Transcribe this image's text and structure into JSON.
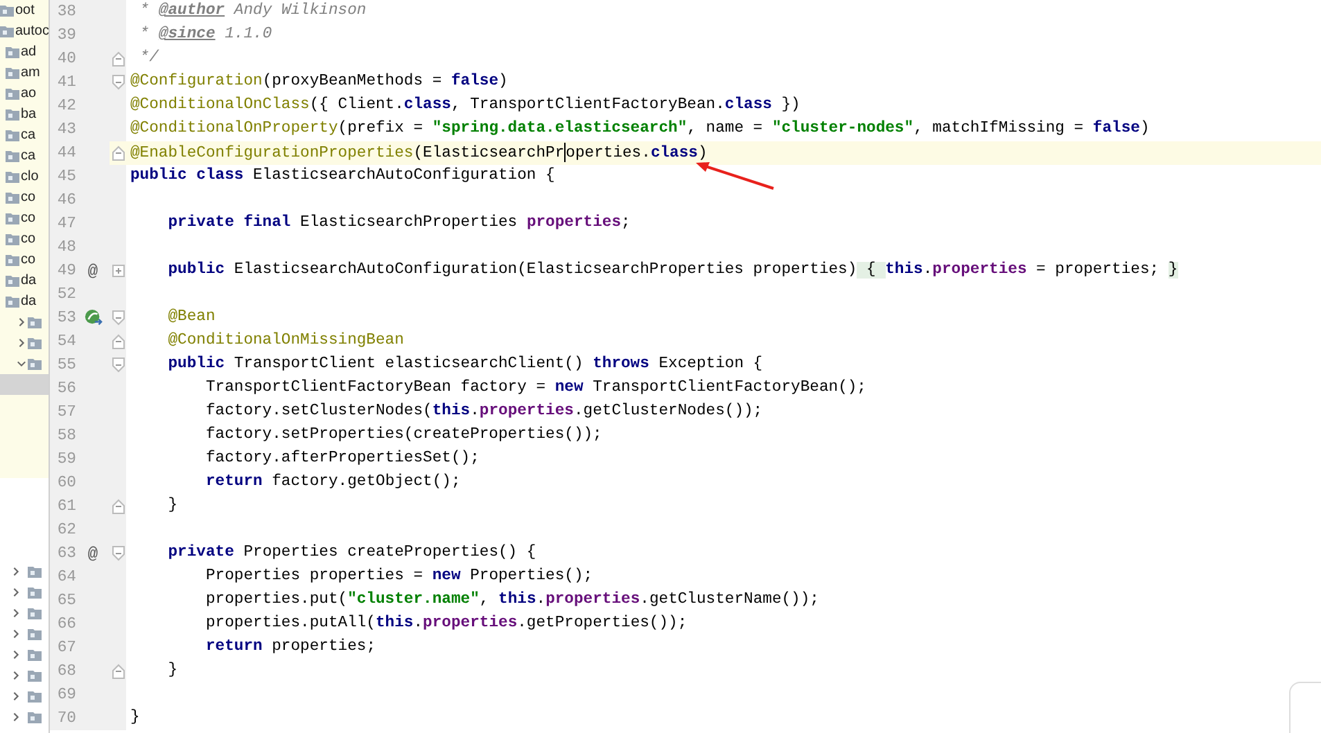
{
  "sidebar": {
    "tree": [
      {
        "label": "oot",
        "selected": false
      },
      {
        "label": "autoc",
        "selected": false,
        "children": [
          {
            "label": "ad",
            "selected": false
          },
          {
            "label": "am",
            "selected": false
          },
          {
            "label": "ao",
            "selected": false
          },
          {
            "label": "ba",
            "selected": false
          },
          {
            "label": "ca",
            "selected": false
          },
          {
            "label": "ca",
            "selected": false
          },
          {
            "label": "clo",
            "selected": false
          },
          {
            "label": "co",
            "selected": false
          },
          {
            "label": "co",
            "selected": false
          },
          {
            "label": "co",
            "selected": false
          },
          {
            "label": "co",
            "selected": false
          },
          {
            "label": "da",
            "selected": false
          },
          {
            "label": "da",
            "selected": false,
            "children": [
              {
                "selected": false,
                "expanded": false
              },
              {
                "selected": false,
                "expanded": false
              },
              {
                "selected": false,
                "expanded": true,
                "children": [
                  {
                    "selected": true
                  }
                ]
              }
            ]
          }
        ]
      }
    ],
    "lower_items": [
      {
        "selected": false,
        "expanded": false
      },
      {
        "selected": false,
        "expanded": false
      },
      {
        "selected": false,
        "expanded": false
      },
      {
        "selected": false,
        "expanded": false
      },
      {
        "selected": false,
        "expanded": false
      },
      {
        "selected": false,
        "expanded": false
      },
      {
        "selected": false,
        "expanded": false
      },
      {
        "selected": false,
        "expanded": false
      }
    ]
  },
  "editor": {
    "lines": [
      {
        "number": "38",
        "tokens": [
          {
            "kind": "comment",
            "t": " * "
          },
          {
            "kind": "doctag",
            "t": "@author"
          },
          {
            "kind": "comment",
            "t": " Andy Wilkinson"
          }
        ]
      },
      {
        "number": "39",
        "tokens": [
          {
            "kind": "comment",
            "t": " * "
          },
          {
            "kind": "doctag",
            "t": "@since"
          },
          {
            "kind": "comment",
            "t": " 1.1.0"
          }
        ]
      },
      {
        "number": "40",
        "fold": {
          "kind": "close"
        },
        "tokens": [
          {
            "kind": "comment",
            "t": " */"
          }
        ]
      },
      {
        "number": "41",
        "fold": {
          "kind": "open"
        },
        "tokens": [
          {
            "kind": "ann",
            "t": "@Configuration"
          },
          {
            "kind": "plain",
            "t": "(proxyBeanMethods = "
          },
          {
            "kind": "kw",
            "t": "false"
          },
          {
            "kind": "plain",
            "t": ")"
          }
        ]
      },
      {
        "number": "42",
        "tokens": [
          {
            "kind": "ann",
            "t": "@ConditionalOnClass"
          },
          {
            "kind": "plain",
            "t": "({ Client."
          },
          {
            "kind": "kw",
            "t": "class"
          },
          {
            "kind": "plain",
            "t": ", TransportClientFactoryBean."
          },
          {
            "kind": "kw",
            "t": "class"
          },
          {
            "kind": "plain",
            "t": " })"
          }
        ]
      },
      {
        "number": "43",
        "tokens": [
          {
            "kind": "ann",
            "t": "@ConditionalOnProperty"
          },
          {
            "kind": "plain",
            "t": "(prefix = "
          },
          {
            "kind": "str",
            "t": "\"spring.data.elasticsearch\""
          },
          {
            "kind": "plain",
            "t": ", name = "
          },
          {
            "kind": "str",
            "t": "\"cluster-nodes\""
          },
          {
            "kind": "plain",
            "t": ", matchIfMissing = "
          },
          {
            "kind": "kw",
            "t": "false"
          },
          {
            "kind": "plain",
            "t": ")"
          }
        ]
      },
      {
        "number": "44",
        "fold": {
          "kind": "close"
        },
        "current": true,
        "tokens": [
          {
            "kind": "ann",
            "t": "@EnableConfigurationProperties"
          },
          {
            "kind": "plain",
            "t": "(ElasticsearchPr"
          },
          {
            "kind": "caret"
          },
          {
            "kind": "plain",
            "t": "operties."
          },
          {
            "kind": "kw",
            "t": "class"
          },
          {
            "kind": "plain",
            "t": ")"
          }
        ]
      },
      {
        "number": "45",
        "tokens": [
          {
            "kind": "kw",
            "t": "public class "
          },
          {
            "kind": "plain",
            "t": "ElasticsearchAutoConfiguration {"
          }
        ]
      },
      {
        "number": "46"
      },
      {
        "number": "47",
        "tokens": [
          {
            "kind": "kw",
            "t": "    private final "
          },
          {
            "kind": "plain",
            "t": "ElasticsearchProperties "
          },
          {
            "kind": "field",
            "t": "properties"
          },
          {
            "kind": "plain",
            "t": ";"
          }
        ]
      },
      {
        "number": "48"
      },
      {
        "number": "49",
        "mark": "@",
        "fold": {
          "kind": "folded"
        },
        "tokens": [
          {
            "kind": "kw",
            "t": "    public "
          },
          {
            "kind": "plain",
            "t": "ElasticsearchAutoConfiguration(ElasticsearchProperties properties)"
          },
          {
            "kind": "fold",
            "t": " { "
          },
          {
            "kind": "kw",
            "t": "this"
          },
          {
            "kind": "plain",
            "t": "."
          },
          {
            "kind": "field",
            "t": "properties"
          },
          {
            "kind": "plain",
            "t": " = properties; "
          },
          {
            "kind": "fold",
            "t": "}"
          }
        ]
      },
      {
        "number": "52"
      },
      {
        "number": "53",
        "kind": "bean",
        "fold": {
          "kind": "open"
        },
        "tokens": [
          {
            "kind": "ann",
            "t": "    @Bean"
          }
        ]
      },
      {
        "number": "54",
        "fold": {
          "kind": "close"
        },
        "tokens": [
          {
            "kind": "ann",
            "t": "    @ConditionalOnMissingBean"
          }
        ]
      },
      {
        "number": "55",
        "fold": {
          "kind": "open"
        },
        "tokens": [
          {
            "kind": "kw",
            "t": "    public "
          },
          {
            "kind": "plain",
            "t": "TransportClient elasticsearchClient() "
          },
          {
            "kind": "kw",
            "t": "throws "
          },
          {
            "kind": "plain",
            "t": "Exception {"
          }
        ]
      },
      {
        "number": "56",
        "tokens": [
          {
            "kind": "plain",
            "t": "        TransportClientFactoryBean factory = "
          },
          {
            "kind": "kw",
            "t": "new "
          },
          {
            "kind": "plain",
            "t": "TransportClientFactoryBean();"
          }
        ]
      },
      {
        "number": "57",
        "tokens": [
          {
            "kind": "plain",
            "t": "        factory.setClusterNodes("
          },
          {
            "kind": "kw",
            "t": "this"
          },
          {
            "kind": "plain",
            "t": "."
          },
          {
            "kind": "field",
            "t": "properties"
          },
          {
            "kind": "plain",
            "t": ".getClusterNodes());"
          }
        ]
      },
      {
        "number": "58",
        "tokens": [
          {
            "kind": "plain",
            "t": "        factory.setProperties(createProperties());"
          }
        ]
      },
      {
        "number": "59",
        "tokens": [
          {
            "kind": "plain",
            "t": "        factory.afterPropertiesSet();"
          }
        ]
      },
      {
        "number": "60",
        "tokens": [
          {
            "kind": "kw",
            "t": "        return "
          },
          {
            "kind": "plain",
            "t": "factory.getObject();"
          }
        ]
      },
      {
        "number": "61",
        "fold": {
          "kind": "close"
        },
        "tokens": [
          {
            "kind": "plain",
            "t": "    }"
          }
        ]
      },
      {
        "number": "62"
      },
      {
        "number": "63",
        "mark": "@",
        "fold": {
          "kind": "open"
        },
        "tokens": [
          {
            "kind": "kw",
            "t": "    private "
          },
          {
            "kind": "plain",
            "t": "Properties createProperties() {"
          }
        ]
      },
      {
        "number": "64",
        "tokens": [
          {
            "kind": "plain",
            "t": "        Properties properties = "
          },
          {
            "kind": "kw",
            "t": "new "
          },
          {
            "kind": "plain",
            "t": "Properties();"
          }
        ]
      },
      {
        "number": "65",
        "tokens": [
          {
            "kind": "plain",
            "t": "        properties.put("
          },
          {
            "kind": "str",
            "t": "\"cluster.name\""
          },
          {
            "kind": "plain",
            "t": ", "
          },
          {
            "kind": "kw",
            "t": "this"
          },
          {
            "kind": "plain",
            "t": "."
          },
          {
            "kind": "field",
            "t": "properties"
          },
          {
            "kind": "plain",
            "t": ".getClusterName());"
          }
        ]
      },
      {
        "number": "66",
        "tokens": [
          {
            "kind": "plain",
            "t": "        properties.putAll("
          },
          {
            "kind": "kw",
            "t": "this"
          },
          {
            "kind": "plain",
            "t": "."
          },
          {
            "kind": "field",
            "t": "properties"
          },
          {
            "kind": "plain",
            "t": ".getProperties());"
          }
        ]
      },
      {
        "number": "67",
        "tokens": [
          {
            "kind": "kw",
            "t": "        return "
          },
          {
            "kind": "plain",
            "t": "properties;"
          }
        ]
      },
      {
        "number": "68",
        "fold": {
          "kind": "close"
        },
        "tokens": [
          {
            "kind": "plain",
            "t": "    }"
          }
        ]
      },
      {
        "number": "69"
      },
      {
        "number": "70",
        "tokens": [
          {
            "kind": "plain",
            "t": "}"
          }
        ]
      }
    ]
  }
}
